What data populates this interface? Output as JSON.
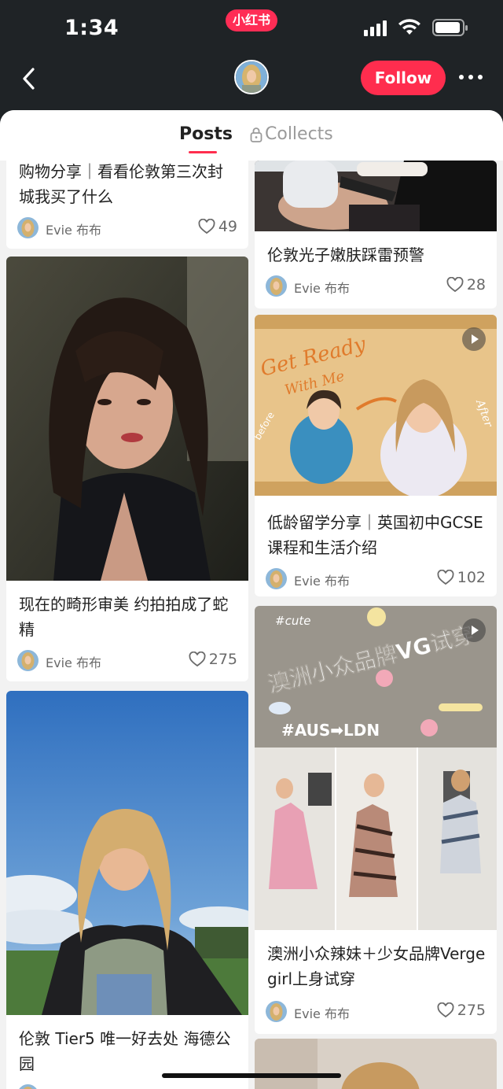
{
  "status_bar": {
    "time": "1:34",
    "app_badge": "小红书"
  },
  "nav": {
    "follow_label": "Follow"
  },
  "tabs": {
    "posts": "Posts",
    "collects": "Collects"
  },
  "author_name": "Evie 布布",
  "posts": [
    {
      "title": "购物分享｜看看伦敦第三次封城我买了什么",
      "likes": "49"
    },
    {
      "title": "伦敦光子嫩肤踩雷预警",
      "likes": "28"
    },
    {
      "title": "现在的畸形审美 约拍拍成了蛇精",
      "likes": "275"
    },
    {
      "title": "低龄留学分享｜英国初中GCSE课程和生活介绍",
      "likes": "102",
      "is_video": true
    },
    {
      "title": "伦敦 Tier5 唯一好去处 海德公园",
      "likes": ""
    },
    {
      "title": "澳洲小众辣妹＋少女品牌Verge girl上身试穿",
      "likes": "275",
      "is_video": true
    }
  ],
  "thumb_texts": {
    "get_ready": "Get Ready",
    "with_me": "With Me",
    "before": "before",
    "after": "After",
    "cute": "#cute",
    "banner": "澳洲小众品牌VG试穿",
    "aus_ldn": "#AUS➡LDN"
  },
  "colors": {
    "accent": "#ff2d4e",
    "header_bg": "#1f2326",
    "feed_bg": "#f2f2f2"
  }
}
